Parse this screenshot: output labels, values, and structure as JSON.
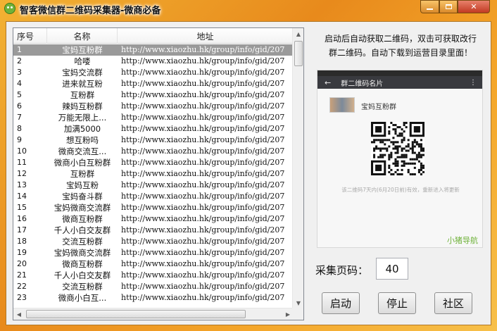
{
  "window": {
    "title": "智客微信群二维码采集器-微商必备"
  },
  "list": {
    "columns": [
      "序号",
      "名称",
      "地址"
    ],
    "rows": [
      {
        "num": "1",
        "name": "宝妈互粉群",
        "addr": "http://www.xiaozhu.hk/group/info/gid/207"
      },
      {
        "num": "2",
        "name": "哈喽",
        "addr": "http://www.xiaozhu.hk/group/info/gid/207"
      },
      {
        "num": "3",
        "name": "宝妈交流群",
        "addr": "http://www.xiaozhu.hk/group/info/gid/207"
      },
      {
        "num": "4",
        "name": "进来就互粉",
        "addr": "http://www.xiaozhu.hk/group/info/gid/207"
      },
      {
        "num": "5",
        "name": "互粉群",
        "addr": "http://www.xiaozhu.hk/group/info/gid/207"
      },
      {
        "num": "6",
        "name": "辣妈互粉群",
        "addr": "http://www.xiaozhu.hk/group/info/gid/207"
      },
      {
        "num": "7",
        "name": "万能无限上...",
        "addr": "http://www.xiaozhu.hk/group/info/gid/207"
      },
      {
        "num": "8",
        "name": "加满5000",
        "addr": "http://www.xiaozhu.hk/group/info/gid/207"
      },
      {
        "num": "9",
        "name": "想互粉吗",
        "addr": "http://www.xiaozhu.hk/group/info/gid/207"
      },
      {
        "num": "10",
        "name": "微商交流互...",
        "addr": "http://www.xiaozhu.hk/group/info/gid/207"
      },
      {
        "num": "11",
        "name": "微商小白互粉群",
        "addr": "http://www.xiaozhu.hk/group/info/gid/207"
      },
      {
        "num": "12",
        "name": "互粉群",
        "addr": "http://www.xiaozhu.hk/group/info/gid/207"
      },
      {
        "num": "13",
        "name": "宝妈互粉",
        "addr": "http://www.xiaozhu.hk/group/info/gid/207"
      },
      {
        "num": "14",
        "name": "宝妈奋斗群",
        "addr": "http://www.xiaozhu.hk/group/info/gid/207"
      },
      {
        "num": "15",
        "name": "宝妈微商交流群",
        "addr": "http://www.xiaozhu.hk/group/info/gid/207"
      },
      {
        "num": "16",
        "name": "微商互粉群",
        "addr": "http://www.xiaozhu.hk/group/info/gid/207"
      },
      {
        "num": "17",
        "name": "千人小白交友群",
        "addr": "http://www.xiaozhu.hk/group/info/gid/207"
      },
      {
        "num": "18",
        "name": "交流互粉群",
        "addr": "http://www.xiaozhu.hk/group/info/gid/207"
      },
      {
        "num": "19",
        "name": "宝妈微商交流群",
        "addr": "http://www.xiaozhu.hk/group/info/gid/207"
      },
      {
        "num": "20",
        "name": "微商互粉群",
        "addr": "http://www.xiaozhu.hk/group/info/gid/207"
      },
      {
        "num": "21",
        "name": "千人小白交友群",
        "addr": "http://www.xiaozhu.hk/group/info/gid/207"
      },
      {
        "num": "22",
        "name": "交流互粉群",
        "addr": "http://www.xiaozhu.hk/group/info/gid/207"
      },
      {
        "num": "23",
        "name": "微商小白互...",
        "addr": "http://www.xiaozhu.hk/group/info/gid/207"
      }
    ],
    "selected_row": 1
  },
  "hint": {
    "line1": "启动后自动获取二维码，双击可获取改行",
    "line2": "群二维码。自动下载到运营目录里面！"
  },
  "preview": {
    "bar_title": "群二维码名片",
    "group_name": "宝妈互粉群",
    "note": "该二维码7天内(6月20日前)有效，重新进入将更新",
    "brand": "小猪导航"
  },
  "controls": {
    "page_label": "采集页码：",
    "page_value": "40",
    "start_label": "启动",
    "stop_label": "停止",
    "community_label": "社区"
  },
  "colors": {
    "accent": "#e88a1c",
    "selection": "#9a9a9a",
    "brand_green": "#6fb23a"
  }
}
